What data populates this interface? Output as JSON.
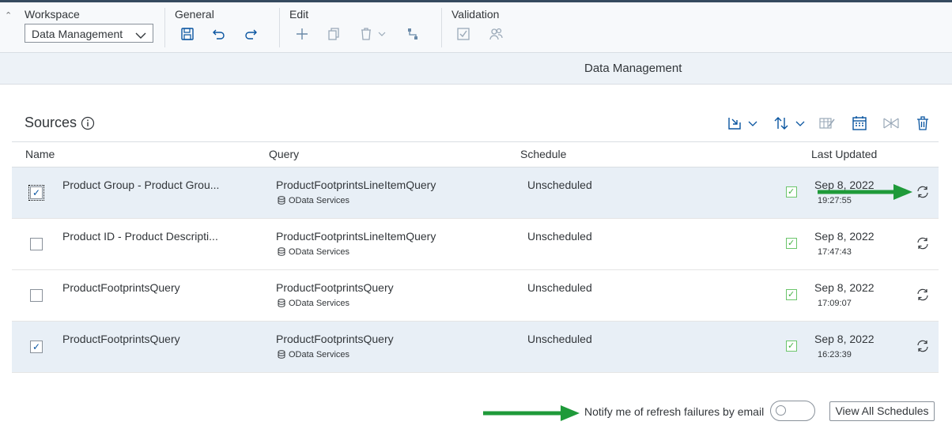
{
  "toolbar": {
    "workspace_label": "Workspace",
    "workspace_value": "Data Management",
    "general_label": "General",
    "edit_label": "Edit",
    "validation_label": "Validation"
  },
  "subheader": {
    "title": "Data Management"
  },
  "sources": {
    "title": "Sources",
    "columns": {
      "name": "Name",
      "query": "Query",
      "schedule": "Schedule",
      "last_updated": "Last Updated"
    },
    "rows": [
      {
        "name": "Product Group - Product Grou...",
        "query": "ProductFootprintsLineItemQuery",
        "type": "OData Services",
        "schedule": "Unscheduled",
        "date": "Sep 8, 2022",
        "time": "19:27:55",
        "checked": true
      },
      {
        "name": "Product ID - Product Descripti...",
        "query": "ProductFootprintsLineItemQuery",
        "type": "OData Services",
        "schedule": "Unscheduled",
        "date": "Sep 8, 2022",
        "time": "17:47:43",
        "checked": false
      },
      {
        "name": "ProductFootprintsQuery",
        "query": "ProductFootprintsQuery",
        "type": "OData Services",
        "schedule": "Unscheduled",
        "date": "Sep 8, 2022",
        "time": "17:09:07",
        "checked": false
      },
      {
        "name": "ProductFootprintsQuery",
        "query": "ProductFootprintsQuery",
        "type": "OData Services",
        "schedule": "Unscheduled",
        "date": "Sep 8, 2022",
        "time": "16:23:39",
        "checked": true
      }
    ]
  },
  "footer": {
    "notify_label": "Notify me of refresh failures by email",
    "view_all_label": "View All Schedules"
  },
  "colors": {
    "accent": "#0854a0",
    "annotation_arrow": "#1f9a3a",
    "status_ok": "#44b044",
    "selected_row": "#e8eff6"
  }
}
